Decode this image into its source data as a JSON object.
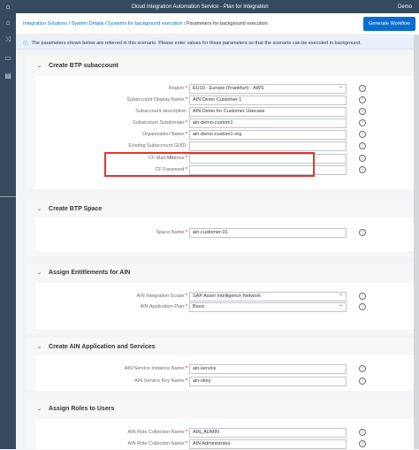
{
  "topbar": {
    "title": "Cloud Integration Automation Service - Plan for Integration",
    "user": "Demo"
  },
  "breadcrumb": {
    "items": [
      "Integration Solutions",
      "System Details",
      "Systems for background execution"
    ],
    "current": "Parameters for background execution"
  },
  "generate_button": "Generate Workflow",
  "info_message": "The parameters shown below are referred in this scenario. Please enter values for these parameters so that the scenario can be executed in background.",
  "sections": [
    {
      "title": "Create BTP subaccount",
      "fields": [
        {
          "label": "Region:",
          "required": true,
          "value": "EU10 - Europe (Frankfurt) - AWS",
          "type": "select"
        },
        {
          "label": "Subaccount Display Name:",
          "required": true,
          "value": "AIN Demo Customer 1",
          "type": "input"
        },
        {
          "label": "Subaccount description:",
          "required": false,
          "value": "AIN Demo for Customer Usecase",
          "type": "input"
        },
        {
          "label": "Subaccount Subdomain:",
          "required": true,
          "value": "ain-demo-custom1",
          "type": "input"
        },
        {
          "label": "Organization Name:",
          "required": true,
          "value": "ain-demo-custom1-org",
          "type": "input"
        },
        {
          "label": "Existing Subaccount GUID:",
          "required": false,
          "value": "",
          "type": "input"
        },
        {
          "label": "CF Mail Address:",
          "required": true,
          "value": "",
          "type": "input"
        },
        {
          "label": "CF Password:",
          "required": true,
          "value": "",
          "type": "input"
        }
      ]
    },
    {
      "title": "Create BTP Space",
      "fields": [
        {
          "label": "Space Name:",
          "required": true,
          "value": "ain-customer-01",
          "type": "input"
        }
      ]
    },
    {
      "title": "Assign Entitlements for AIN",
      "fields": [
        {
          "label": "AIN Integration Scope:",
          "required": true,
          "value": "SAP Asset Intelligence Network",
          "type": "select"
        },
        {
          "label": "AIN Application Plan:",
          "required": true,
          "value": "Basic",
          "type": "select"
        }
      ]
    },
    {
      "title": "Create AIN Application and Services",
      "fields": [
        {
          "label": "AIN Service Instance Name:",
          "required": true,
          "value": "ain-service",
          "type": "input"
        },
        {
          "label": "AIN Service Key Name:",
          "required": true,
          "value": "ain-skey",
          "type": "input"
        }
      ]
    },
    {
      "title": "Assign Roles to Users",
      "fields": [
        {
          "label": "AIN Role Collection Name:",
          "required": true,
          "value": "AIN_ADMIN",
          "type": "input"
        },
        {
          "label": "AIN Role Collection Name:",
          "required": true,
          "value": "AIN Administrator",
          "type": "input"
        }
      ]
    }
  ]
}
